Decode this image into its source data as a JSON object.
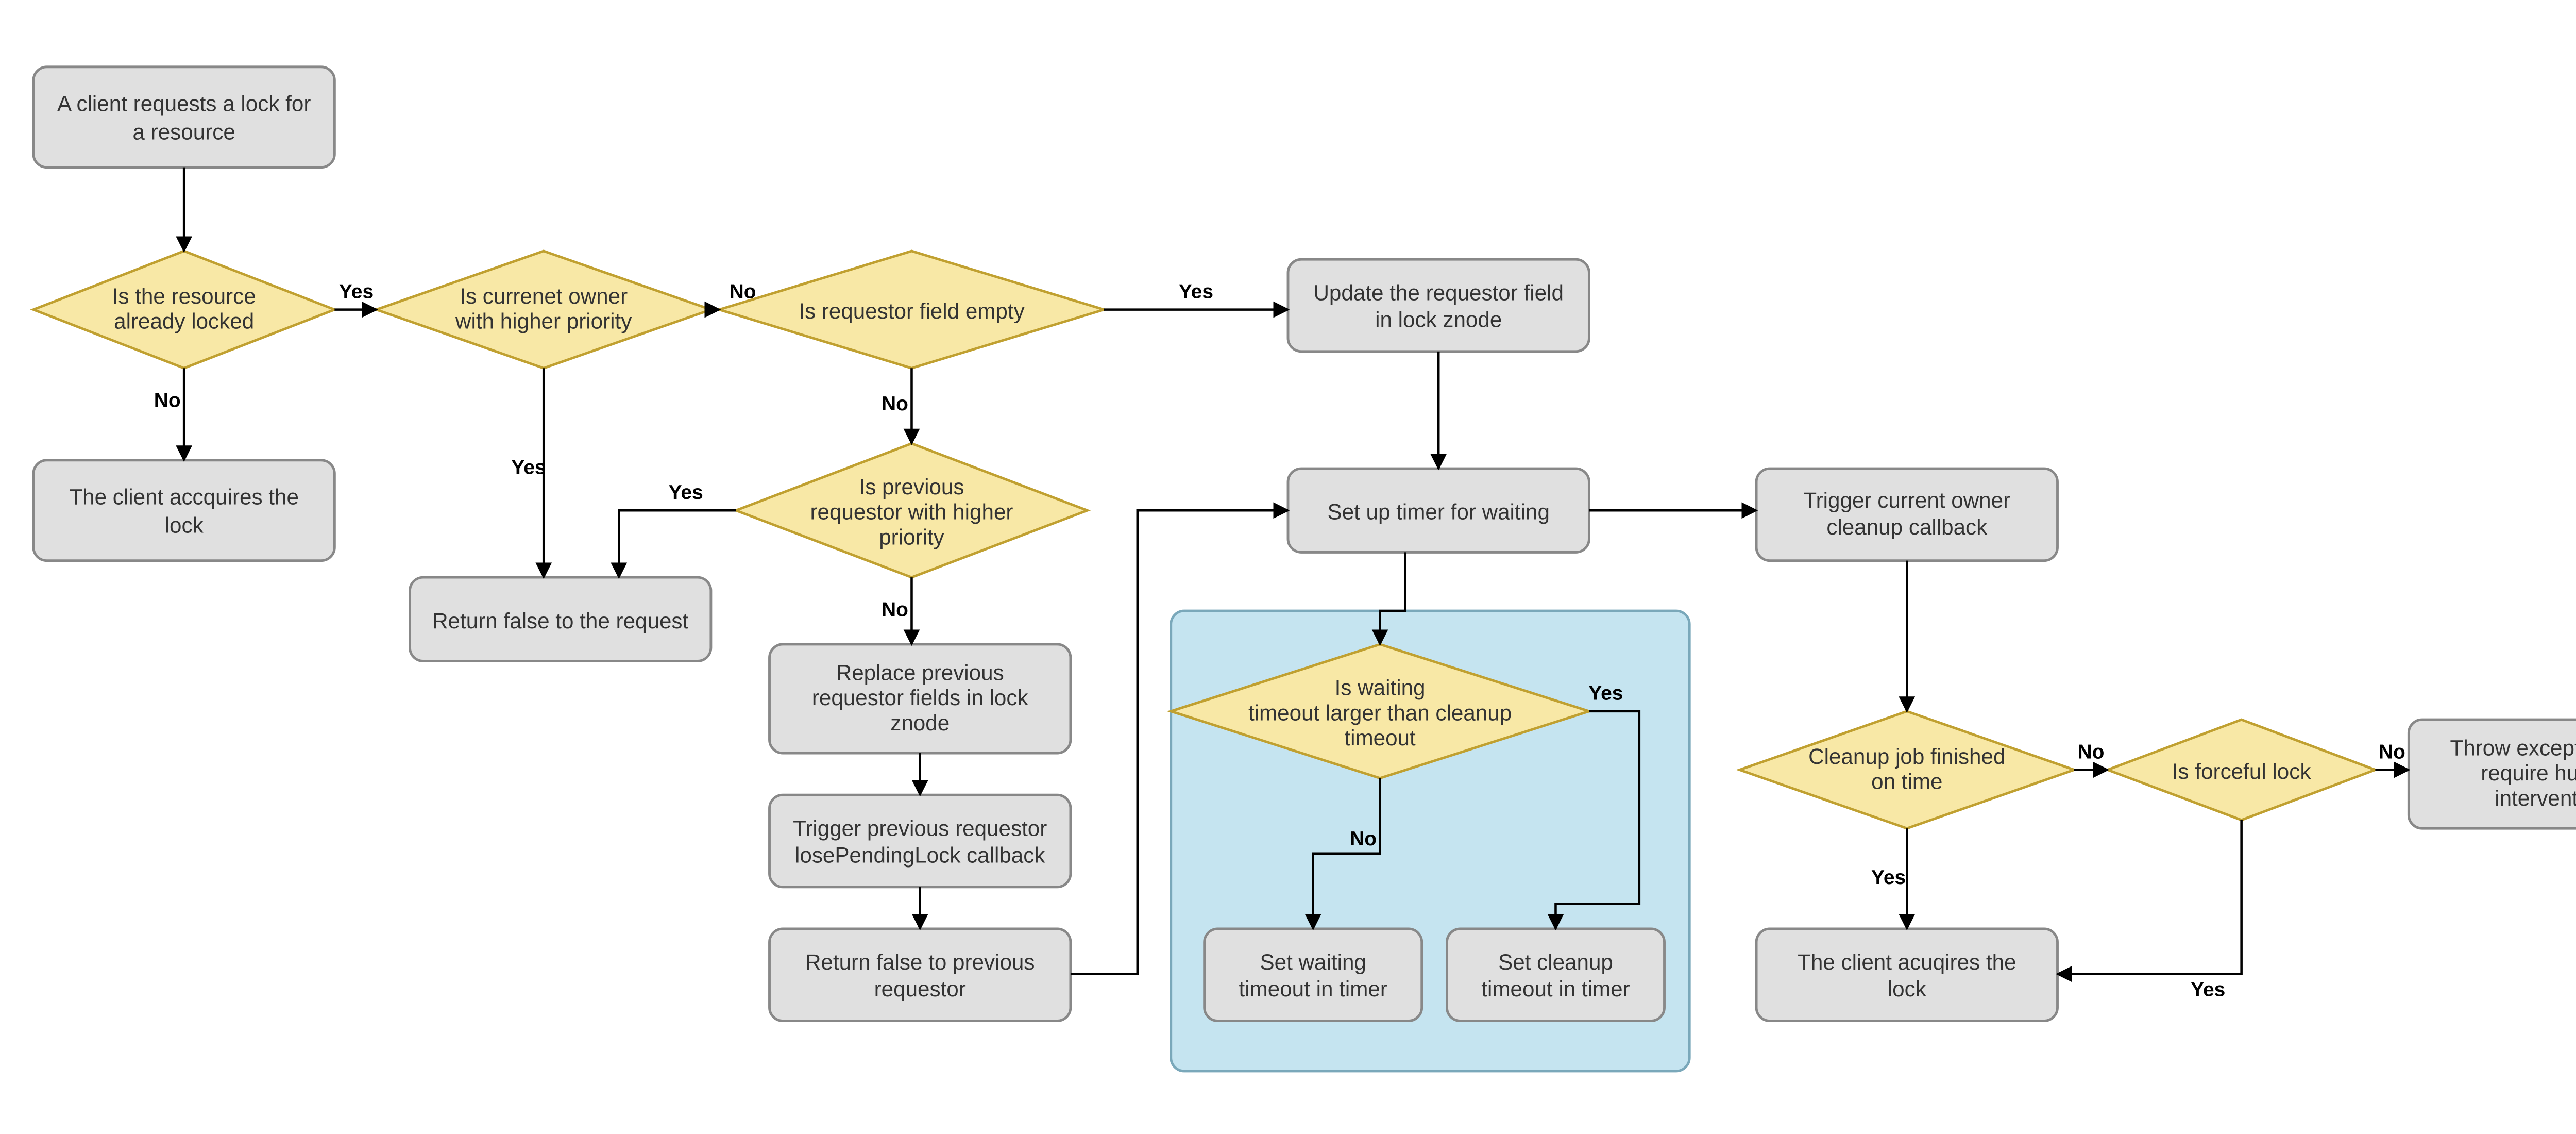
{
  "nodes": {
    "start": {
      "type": "process",
      "text": [
        "A client requests a lock for",
        "a resource"
      ]
    },
    "d_locked": {
      "type": "decision",
      "text": [
        "Is the resource",
        "already locked"
      ]
    },
    "p_acquire1": {
      "type": "process",
      "text": [
        "The client accquires the",
        "lock"
      ]
    },
    "d_owner_pri": {
      "type": "decision",
      "text": [
        "Is currenet owner",
        "with higher priority"
      ]
    },
    "p_retfalse": {
      "type": "process",
      "text": [
        "Return false to the request"
      ]
    },
    "d_req_empty": {
      "type": "decision",
      "text": [
        "Is requestor field empty"
      ]
    },
    "d_prev_pri": {
      "type": "decision",
      "text": [
        "Is previous",
        "requestor with higher",
        "priority"
      ]
    },
    "p_replace": {
      "type": "process",
      "text": [
        "Replace previous",
        "requestor fields in lock",
        "znode"
      ]
    },
    "p_losepend": {
      "type": "process",
      "text": [
        "Trigger previous requestor",
        "losePendingLock callback"
      ]
    },
    "p_retprev": {
      "type": "process",
      "text": [
        "Return false to previous",
        "requestor"
      ]
    },
    "p_update": {
      "type": "process",
      "text": [
        "Update the requestor field",
        "in lock znode"
      ]
    },
    "p_timer": {
      "type": "process",
      "text": [
        "Set up timer for waiting"
      ]
    },
    "d_timeout": {
      "type": "decision",
      "text": [
        "Is waiting",
        "timeout larger than cleanup",
        "timeout"
      ]
    },
    "p_setwait": {
      "type": "process",
      "text": [
        "Set waiting",
        "timeout in timer"
      ]
    },
    "p_setclean": {
      "type": "process",
      "text": [
        "Set cleanup",
        "timeout in timer"
      ]
    },
    "p_trigclean": {
      "type": "process",
      "text": [
        "Trigger current owner",
        "cleanup callback"
      ]
    },
    "d_cleanup_ok": {
      "type": "decision",
      "text": [
        "Cleanup job finished",
        "on time"
      ]
    },
    "p_acquire2": {
      "type": "process",
      "text": [
        "The client acuqires the",
        "lock"
      ]
    },
    "d_forceful": {
      "type": "decision",
      "text": [
        "Is forceful lock"
      ]
    },
    "p_throw": {
      "type": "process",
      "text": [
        "Throw exception and",
        "require human",
        "intervention"
      ]
    }
  },
  "edge_labels": {
    "yes": "Yes",
    "no": "No"
  },
  "chart_data": {
    "type": "flowchart",
    "title": "",
    "nodes": [
      {
        "id": "start",
        "shape": "process",
        "label": "A client requests a lock for a resource"
      },
      {
        "id": "d_locked",
        "shape": "decision",
        "label": "Is the resource already locked"
      },
      {
        "id": "p_acquire1",
        "shape": "process",
        "label": "The client accquires the lock"
      },
      {
        "id": "d_owner_pri",
        "shape": "decision",
        "label": "Is currenet owner with higher priority"
      },
      {
        "id": "p_retfalse",
        "shape": "process",
        "label": "Return false to the request"
      },
      {
        "id": "d_req_empty",
        "shape": "decision",
        "label": "Is requestor field empty"
      },
      {
        "id": "d_prev_pri",
        "shape": "decision",
        "label": "Is previous requestor with higher priority"
      },
      {
        "id": "p_replace",
        "shape": "process",
        "label": "Replace previous requestor fields in lock znode"
      },
      {
        "id": "p_losepend",
        "shape": "process",
        "label": "Trigger previous requestor losePendingLock callback"
      },
      {
        "id": "p_retprev",
        "shape": "process",
        "label": "Return false to previous requestor"
      },
      {
        "id": "p_update",
        "shape": "process",
        "label": "Update the requestor field in lock znode"
      },
      {
        "id": "p_timer",
        "shape": "process",
        "label": "Set up timer for waiting"
      },
      {
        "id": "d_timeout",
        "shape": "decision",
        "label": "Is waiting timeout larger than cleanup timeout"
      },
      {
        "id": "p_setwait",
        "shape": "process",
        "label": "Set waiting timeout in timer"
      },
      {
        "id": "p_setclean",
        "shape": "process",
        "label": "Set cleanup timeout in timer"
      },
      {
        "id": "p_trigclean",
        "shape": "process",
        "label": "Trigger current owner cleanup callback"
      },
      {
        "id": "d_cleanup_ok",
        "shape": "decision",
        "label": "Cleanup job finished on time"
      },
      {
        "id": "p_acquire2",
        "shape": "process",
        "label": "The client acuqires the lock"
      },
      {
        "id": "d_forceful",
        "shape": "decision",
        "label": "Is forceful lock"
      },
      {
        "id": "p_throw",
        "shape": "process",
        "label": "Throw exception and require human intervention"
      }
    ],
    "edges": [
      {
        "from": "start",
        "to": "d_locked",
        "label": ""
      },
      {
        "from": "d_locked",
        "to": "p_acquire1",
        "label": "No"
      },
      {
        "from": "d_locked",
        "to": "d_owner_pri",
        "label": "Yes"
      },
      {
        "from": "d_owner_pri",
        "to": "p_retfalse",
        "label": "Yes"
      },
      {
        "from": "d_owner_pri",
        "to": "d_req_empty",
        "label": "No"
      },
      {
        "from": "d_req_empty",
        "to": "p_update",
        "label": "Yes"
      },
      {
        "from": "d_req_empty",
        "to": "d_prev_pri",
        "label": "No"
      },
      {
        "from": "d_prev_pri",
        "to": "p_retfalse",
        "label": "Yes"
      },
      {
        "from": "d_prev_pri",
        "to": "p_replace",
        "label": "No"
      },
      {
        "from": "p_replace",
        "to": "p_losepend",
        "label": ""
      },
      {
        "from": "p_losepend",
        "to": "p_retprev",
        "label": ""
      },
      {
        "from": "p_retprev",
        "to": "p_timer",
        "label": ""
      },
      {
        "from": "p_update",
        "to": "p_timer",
        "label": ""
      },
      {
        "from": "p_timer",
        "to": "d_timeout",
        "label": ""
      },
      {
        "from": "d_timeout",
        "to": "p_setwait",
        "label": "No"
      },
      {
        "from": "d_timeout",
        "to": "p_setclean",
        "label": "Yes"
      },
      {
        "from": "p_timer",
        "to": "p_trigclean",
        "label": ""
      },
      {
        "from": "p_trigclean",
        "to": "d_cleanup_ok",
        "label": ""
      },
      {
        "from": "d_cleanup_ok",
        "to": "p_acquire2",
        "label": "Yes"
      },
      {
        "from": "d_cleanup_ok",
        "to": "d_forceful",
        "label": "No"
      },
      {
        "from": "d_forceful",
        "to": "p_acquire2",
        "label": "Yes"
      },
      {
        "from": "d_forceful",
        "to": "p_throw",
        "label": "No"
      }
    ],
    "groups": [
      {
        "id": "timeout_group",
        "label": "",
        "members": [
          "d_timeout",
          "p_setwait",
          "p_setclean"
        ]
      }
    ]
  }
}
